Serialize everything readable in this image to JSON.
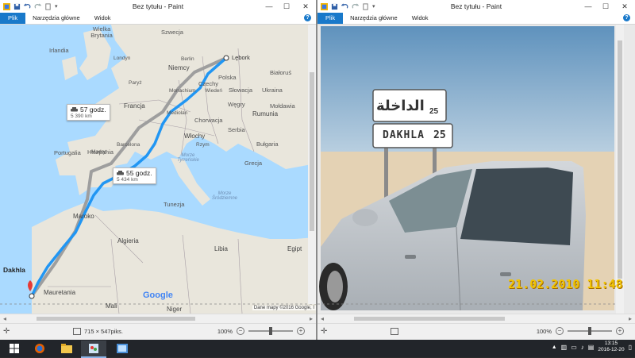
{
  "left_window": {
    "title": "Bez tytułu - Paint",
    "tabs": [
      "Plik",
      "Narzędzia główne",
      "Widok"
    ],
    "help_label": "?",
    "status": {
      "dimensions": "715 × 547piks.",
      "zoom": "100%"
    },
    "map": {
      "countries": [
        "Szwecja",
        "Irlandia",
        "Wielka Brytania",
        "Białoruś",
        "Polska",
        "Niemcy",
        "Czechy",
        "Słowacja",
        "Ukraina",
        "Węgry",
        "Mołdawia",
        "Francja",
        "Chorwacja",
        "Rumunia",
        "Serbia",
        "Bułgaria",
        "Włochy",
        "Portugalia",
        "Hiszpania",
        "Grecja",
        "Maroko",
        "Tunezja",
        "Algieria",
        "Libia",
        "Egipt",
        "Mauretania",
        "Mali",
        "Niger"
      ],
      "cities": [
        "Londyn",
        "Lębork",
        "Berlin",
        "Paryż",
        "Monachium",
        "Wiedeń",
        "Mediolan",
        "Barcelona",
        "Madryt",
        "Rzym",
        "Dakhla"
      ],
      "seas": [
        "Morze Tyrreńskie",
        "Morze Śródziemne"
      ],
      "route_a": {
        "time": "57 godz.",
        "distance": "5 390 km"
      },
      "route_b": {
        "time": "55 godz.",
        "distance": "5 434 km"
      },
      "google_logo": "Google",
      "attribution": "Dane mapy ©2016 Google, I"
    }
  },
  "right_window": {
    "title": "Bez tytułu - Paint",
    "tabs": [
      "Plik",
      "Narzędzia główne",
      "Widok"
    ],
    "help_label": "?",
    "status": {
      "zoom": "100%"
    },
    "photo": {
      "sign_arabic": "الداخلة",
      "sign_arabic_num": "25",
      "sign_latin": "DAKHLA",
      "sign_latin_num": "25",
      "timestamp": "21.02.2010  11:48"
    }
  },
  "taskbar": {
    "time": "13:15",
    "date": "2016-12-20"
  }
}
